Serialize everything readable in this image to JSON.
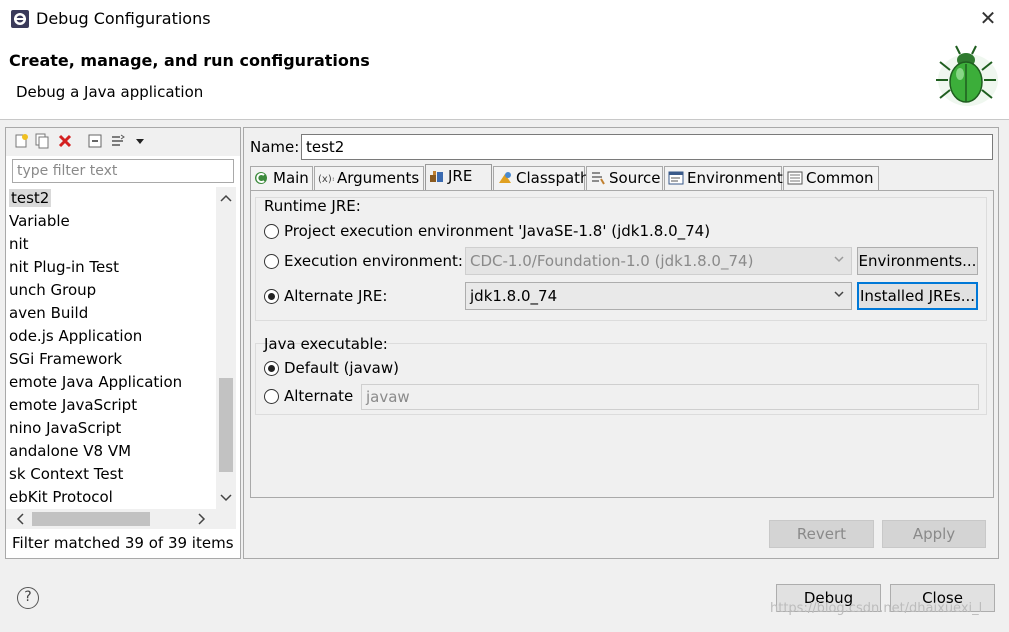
{
  "window": {
    "title": "Debug Configurations",
    "close_glyph": "✕"
  },
  "banner": {
    "title": "Create, manage, and run configurations",
    "subtitle": "Debug a Java application",
    "icon": "bug-icon"
  },
  "left": {
    "filter_placeholder": "type filter text",
    "items": [
      {
        "label": "test2",
        "selected": true
      },
      {
        "label": "Variable"
      },
      {
        "label": "nit"
      },
      {
        "label": "nit Plug-in Test"
      },
      {
        "label": "unch Group"
      },
      {
        "label": "aven Build"
      },
      {
        "label": "ode.js Application"
      },
      {
        "label": "SGi Framework"
      },
      {
        "label": "emote Java Application"
      },
      {
        "label": "emote JavaScript"
      },
      {
        "label": "nino JavaScript"
      },
      {
        "label": "andalone V8 VM"
      },
      {
        "label": "sk Context Test"
      },
      {
        "label": "ebKit Protocol"
      }
    ],
    "status": "Filter matched 39 of 39 items"
  },
  "right": {
    "name_label": "Name:",
    "name_value": "test2",
    "tabs": [
      {
        "label": "Main",
        "icon": "main-icon"
      },
      {
        "label": "Arguments",
        "icon": "arguments-icon"
      },
      {
        "label": "JRE",
        "icon": "jre-icon",
        "active": true
      },
      {
        "label": "Classpath",
        "icon": "classpath-icon"
      },
      {
        "label": "Source",
        "icon": "source-icon"
      },
      {
        "label": "Environment",
        "icon": "environment-icon"
      },
      {
        "label": "Common",
        "icon": "common-icon"
      }
    ],
    "runtime": {
      "label": "Runtime JRE:",
      "project_env": "Project execution environment 'JavaSE-1.8' (jdk1.8.0_74)",
      "exec_env_label": "Execution environment:",
      "exec_env_value": "CDC-1.0/Foundation-1.0 (jdk1.8.0_74)",
      "environments_button": "Environments...",
      "alt_jre_label": "Alternate JRE:",
      "alt_jre_value": "jdk1.8.0_74",
      "installed_button": "Installed JREs...",
      "selected": "alternate"
    },
    "java_exec": {
      "label": "Java executable:",
      "default_label": "Default (javaw)",
      "alternate_label": "Alternate",
      "alternate_value": "javaw",
      "selected": "default"
    },
    "revert_button": "Revert",
    "apply_button": "Apply"
  },
  "bottom": {
    "debug_button": "Debug",
    "close_button": "Close",
    "help_glyph": "?",
    "watermark": "https://blog.csdn.net/dhaixuexi_l"
  },
  "colors": {
    "focus_border": "#0078d7",
    "bug_green": "#3cae3a"
  }
}
